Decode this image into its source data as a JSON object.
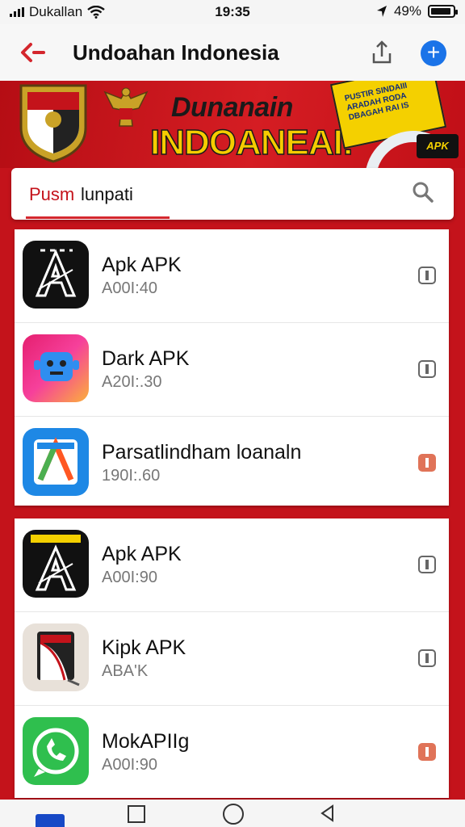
{
  "status_bar": {
    "carrier": "Dukallan",
    "time": "19:35",
    "battery": "49%",
    "icons": [
      "signal-icon",
      "wifi-icon",
      "location-icon",
      "battery-icon"
    ]
  },
  "header": {
    "title": "Undoahan Indonesia",
    "icons": [
      "back-arrow-icon",
      "share-icon",
      "plus-icon"
    ]
  },
  "banner": {
    "line1": "Dunanain",
    "line2": "INDOANEAI!",
    "promo_lines": [
      "PUSTIR SINDAIII",
      "ARADAH RODA",
      "DBAGAH RAI IS"
    ],
    "badge": "APK",
    "colors": {
      "red": "#c4131b",
      "yellow": "#f4d000"
    }
  },
  "search": {
    "prefix": "Pusm",
    "value": "lunpati",
    "icon": "search-icon"
  },
  "apps": [
    {
      "name": "Apk APK",
      "meta": "A00I:40",
      "icon": "a-logo-icon",
      "info_style": "plain"
    },
    {
      "name": "Dark APK",
      "meta": "A20I:.30",
      "icon": "robot-face-icon",
      "info_style": "plain"
    },
    {
      "name": "Parsatlindham loanaln",
      "meta": "190I:.60",
      "icon": "a-gradient-icon",
      "info_style": "accent"
    },
    {
      "name": "Apk APK",
      "meta": "A00I:90",
      "icon": "a-logo-icon",
      "info_style": "plain"
    },
    {
      "name": "Kipk APK",
      "meta": "ABA'K",
      "icon": "book-icon",
      "info_style": "plain"
    },
    {
      "name": "MokAPIIg",
      "meta": "A00I:90",
      "icon": "chat-icon",
      "info_style": "accent"
    }
  ],
  "nav": {
    "icons": [
      "recent-apps-icon",
      "home-icon",
      "back-icon"
    ]
  }
}
